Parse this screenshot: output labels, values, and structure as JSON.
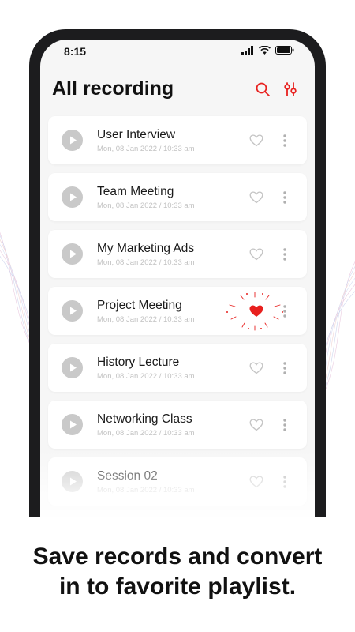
{
  "status": {
    "time": "8:15",
    "icons": [
      "signal-icon",
      "wifi-icon",
      "battery-icon"
    ]
  },
  "header": {
    "title": "All recording",
    "search_icon": "search-icon",
    "filter_icon": "filter-icon"
  },
  "recordings": [
    {
      "title": "User Interview",
      "date": "Mon, 08 Jan 2022 / 10:33 am",
      "favorite": false
    },
    {
      "title": "Team Meeting",
      "date": "Mon, 08 Jan 2022 / 10:33 am",
      "favorite": false
    },
    {
      "title": "My Marketing Ads",
      "date": "Mon, 08 Jan 2022 / 10:33 am",
      "favorite": false
    },
    {
      "title": "Project Meeting",
      "date": "Mon, 08 Jan 2022 / 10:33 am",
      "favorite": true
    },
    {
      "title": "History Lecture",
      "date": "Mon, 08 Jan 2022 / 10:33 am",
      "favorite": false
    },
    {
      "title": "Networking Class",
      "date": "Mon, 08 Jan 2022 / 10:33 am",
      "favorite": false
    },
    {
      "title": "Session 02",
      "date": "Mon, 08 Jan 2022 / 10:33 am",
      "favorite": false
    }
  ],
  "caption": {
    "line1": "Save records and convert",
    "line2": "in to favorite playlist."
  },
  "colors": {
    "accent": "#e8201e",
    "icon_gray": "#c9c9c9",
    "phone_frame": "#1c1c1e",
    "screen_bg": "#f6f6f6"
  }
}
